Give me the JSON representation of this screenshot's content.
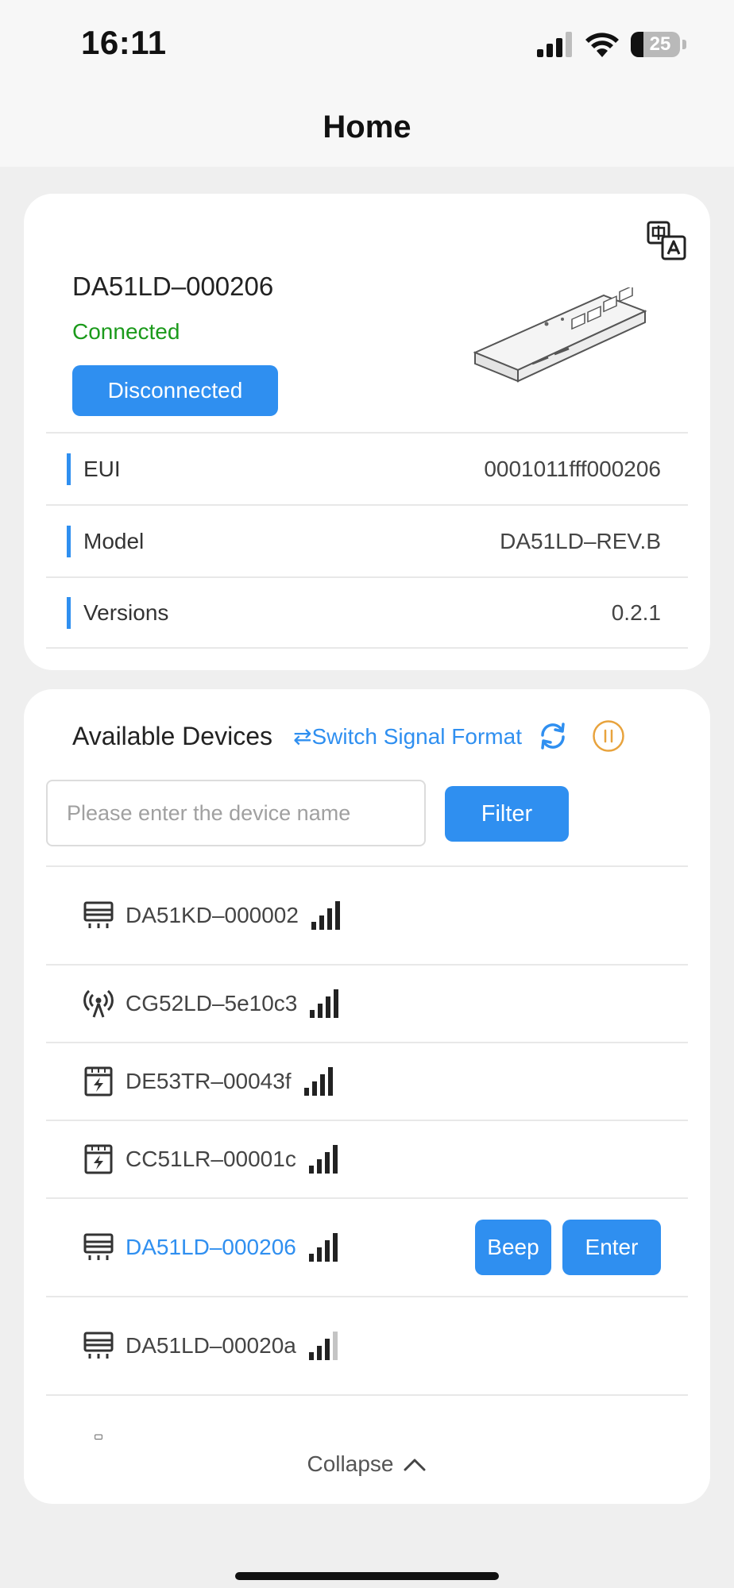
{
  "status_bar": {
    "time": "16:11",
    "battery": "25"
  },
  "nav": {
    "title": "Home"
  },
  "device": {
    "name": "DA51LD–000206",
    "status": "Connected",
    "disconnect_label": "Disconnected",
    "info": [
      {
        "label": "EUI",
        "value": "0001011fff000206"
      },
      {
        "label": "Model",
        "value": "DA51LD–REV.B"
      },
      {
        "label": "Versions",
        "value": "0.2.1"
      }
    ]
  },
  "available": {
    "title": "Available Devices",
    "switch_format": "⇄Switch Signal Format",
    "search_placeholder": "Please enter the device name",
    "filter_label": "Filter",
    "devices": [
      {
        "name": "DA51KD–000002",
        "icon": "gateway-device-icon",
        "signal_bars": 4
      },
      {
        "name": "CG52LD–5e10c3",
        "icon": "broadcast-antenna-icon",
        "signal_bars": 4
      },
      {
        "name": "DE53TR–00043f",
        "icon": "power-meter-icon",
        "signal_bars": 4
      },
      {
        "name": "CC51LR–00001c",
        "icon": "power-meter-icon",
        "signal_bars": 4
      },
      {
        "name": "DA51LD–000206",
        "icon": "gateway-device-icon",
        "signal_bars": 4,
        "selected": true
      },
      {
        "name": "DA51LD–00020a",
        "icon": "gateway-device-icon",
        "signal_bars": 3
      }
    ],
    "beep_label": "Beep",
    "enter_label": "Enter",
    "collapse_label": "Collapse"
  },
  "colors": {
    "accent": "#2f8ff0",
    "connected": "#1b9a1b",
    "pause": "#e8a33d"
  }
}
